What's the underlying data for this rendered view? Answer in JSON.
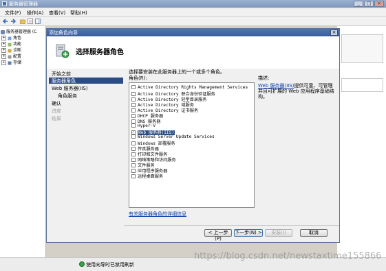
{
  "main_window": {
    "title": "服务器管理器",
    "controls": {
      "minimize": "_",
      "maximize": "□",
      "close": "×"
    },
    "menu": [
      "文件(F)",
      "操作(A)",
      "查看(V)",
      "帮助(H)"
    ]
  },
  "tree": {
    "root": "服务器管理器 (C",
    "items": [
      "角色",
      "功能",
      "诊断",
      "配置",
      "存储"
    ]
  },
  "dialog": {
    "title": "添加角色向导",
    "close": "×",
    "heading": "选择服务器角色",
    "nav": [
      {
        "label": "开始之前",
        "state": "normal"
      },
      {
        "label": "服务器角色",
        "state": "selected"
      },
      {
        "label": "Web 服务器(IIS)",
        "state": "normal"
      },
      {
        "label": "角色服务",
        "state": "normal"
      },
      {
        "label": "确认",
        "state": "normal"
      },
      {
        "label": "进度",
        "state": "disabled"
      },
      {
        "label": "结果",
        "state": "disabled"
      }
    ],
    "instruction": "选择要安装在此服务器上的一个或多个角色。",
    "roles_label": "角色(R):",
    "roles": [
      {
        "label": "Active Directory Rights Management Services",
        "checked": false
      },
      {
        "label": "Active Directory 联合身份验证服务",
        "checked": false
      },
      {
        "label": "Active Directory 轻型目录服务",
        "checked": false
      },
      {
        "label": "Active Directory 域服务",
        "checked": false
      },
      {
        "label": "Active Directory 证书服务",
        "checked": false
      },
      {
        "label": "DHCP 服务器",
        "checked": false
      },
      {
        "label": "DNS 服务器",
        "checked": false
      },
      {
        "label": "Hyper-V",
        "checked": false
      },
      {
        "label": "Web 服务器(IIS)",
        "checked": true,
        "selected": true
      },
      {
        "label": "Windows Server Update Services",
        "checked": false
      },
      {
        "label": "Windows 部署服务",
        "checked": false
      },
      {
        "label": "传真服务器",
        "checked": false
      },
      {
        "label": "打印和文件服务",
        "checked": false
      },
      {
        "label": "网络策略和访问服务",
        "checked": false
      },
      {
        "label": "文件服务",
        "checked": false
      },
      {
        "label": "应用程序服务器",
        "checked": false
      },
      {
        "label": "远程桌面服务",
        "checked": false
      }
    ],
    "description_label": "描述:",
    "description_link": "Web 服务器(IIS)",
    "description_lines": [
      "提供可靠、可管理",
      "并且可扩展的 Web 应用程序基础结",
      "构。"
    ],
    "more_info_link": "有关服务器角色的详细信息",
    "buttons": {
      "back": "< 上一步(P)",
      "next": "下一步(N) >",
      "install": "安装(I)",
      "cancel": "取消"
    }
  },
  "status_bar": {
    "text": "使用向导时已禁用刷新"
  },
  "watermark": "https://blog.csdn.net/newstaxtime155866"
}
